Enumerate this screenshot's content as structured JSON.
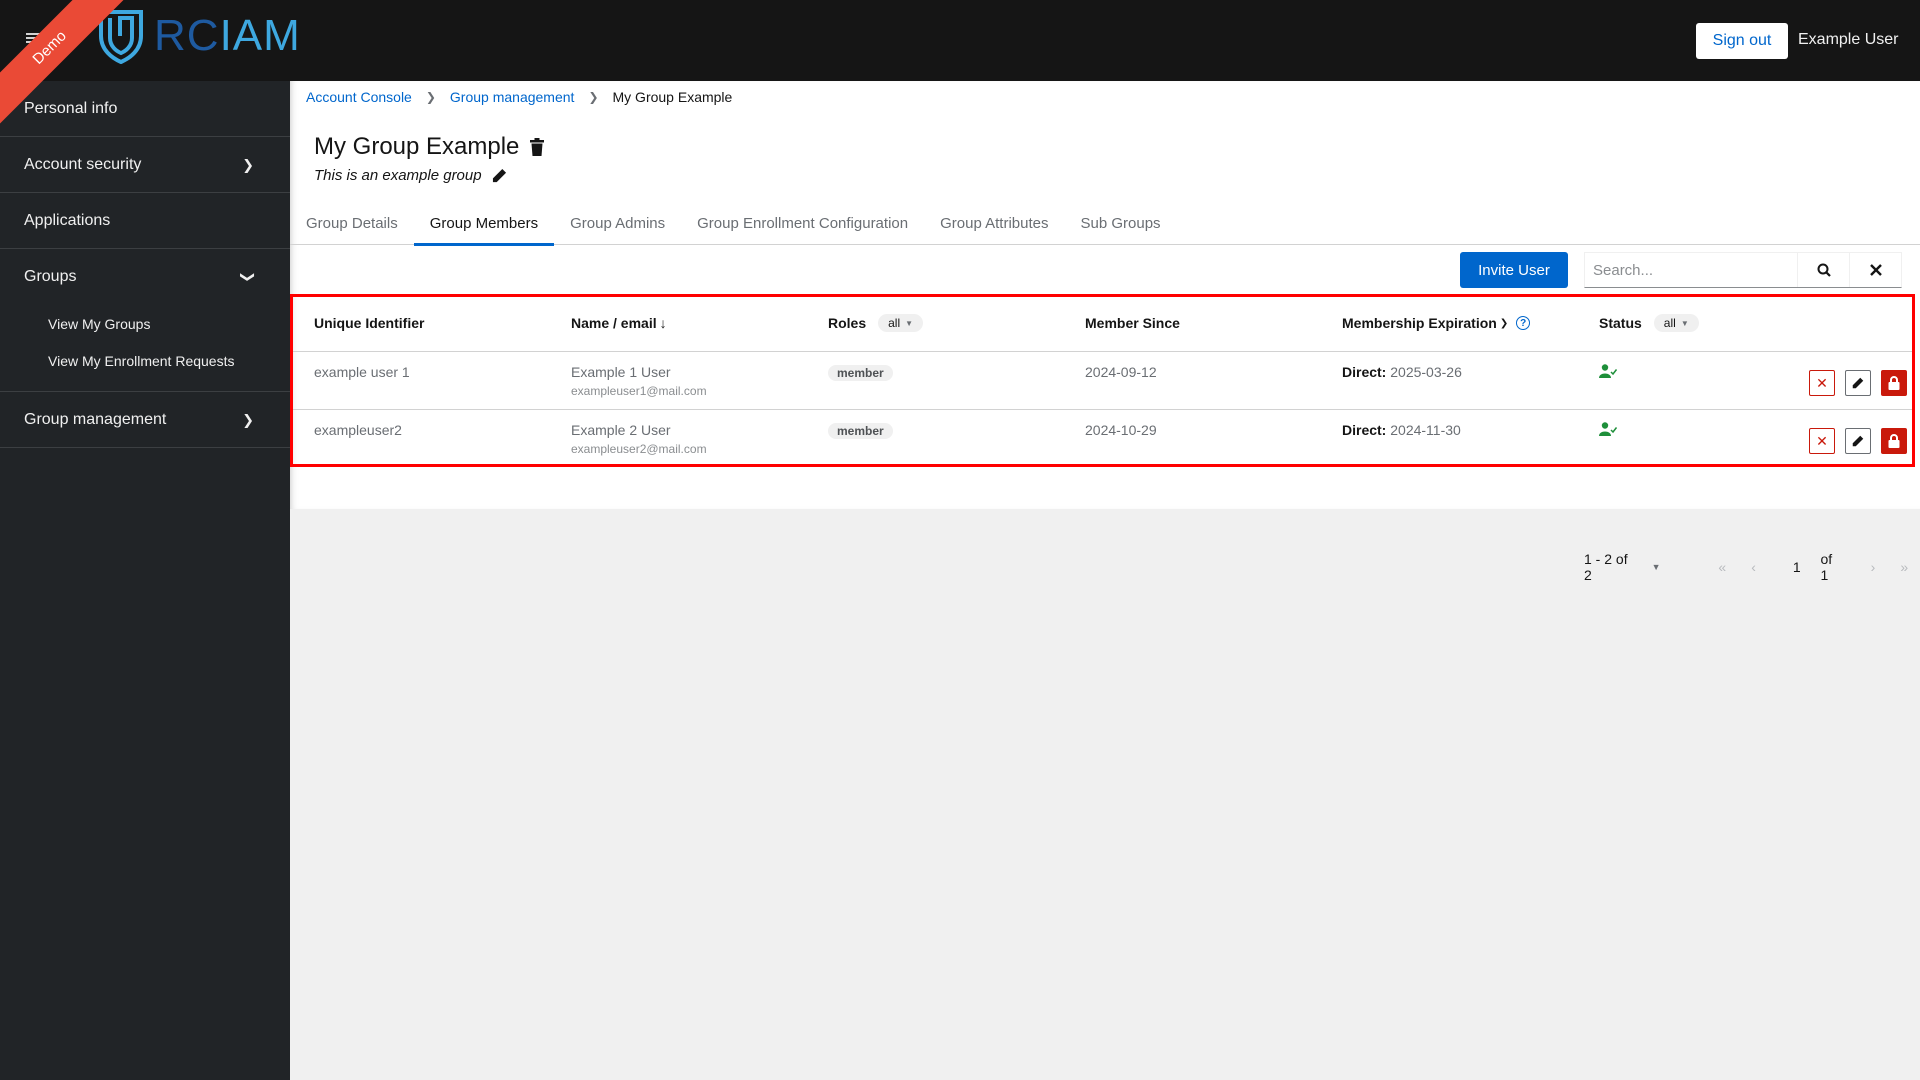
{
  "header": {
    "ribbon_label": "Demo",
    "logo_text_rc": "RC",
    "logo_text_iam": "IAM",
    "signout_label": "Sign out",
    "user_name": "Example User"
  },
  "sidebar": {
    "items": [
      {
        "label": "Personal info"
      },
      {
        "label": "Account security",
        "icon": "chevron-right-icon"
      },
      {
        "label": "Applications"
      },
      {
        "label": "Groups",
        "icon": "chevron-down-icon",
        "children": [
          {
            "label": "View My Groups"
          },
          {
            "label": "View My Enrollment Requests"
          }
        ]
      },
      {
        "label": "Group management",
        "icon": "chevron-right-icon"
      }
    ]
  },
  "breadcrumb": {
    "items": [
      "Account Console",
      "Group management",
      "My Group Example"
    ]
  },
  "page": {
    "title": "My Group Example",
    "description": "This is an example group"
  },
  "tabs": [
    {
      "label": "Group Details",
      "active": false
    },
    {
      "label": "Group Members",
      "active": true
    },
    {
      "label": "Group Admins",
      "active": false
    },
    {
      "label": "Group Enrollment Configuration",
      "active": false
    },
    {
      "label": "Group Attributes",
      "active": false
    },
    {
      "label": "Sub Groups",
      "active": false
    }
  ],
  "toolbar": {
    "invite_label": "Invite User",
    "search_placeholder": "Search...",
    "search_value": ""
  },
  "table": {
    "headers": {
      "id": "Unique Identifier",
      "name": "Name / email",
      "name_sort": "↓",
      "roles": "Roles",
      "roles_filter": "all",
      "since": "Member Since",
      "expiration": "Membership Expiration",
      "status": "Status",
      "status_filter": "all"
    },
    "rows": [
      {
        "id": "example user 1",
        "name": "Example 1 User",
        "email": "exampleuser1@mail.com",
        "role": "member",
        "since": "2024-09-12",
        "exp_label": "Direct:",
        "exp_date": "2025-03-26",
        "status": "active-member-icon"
      },
      {
        "id": "exampleuser2",
        "name": "Example 2 User",
        "email": "exampleuser2@mail.com",
        "role": "member",
        "since": "2024-10-29",
        "exp_label": "Direct:",
        "exp_date": "2024-11-30",
        "status": "active-member-icon"
      }
    ]
  },
  "pagination": {
    "range": "1 - 2 of 2",
    "current_page": "1",
    "of_pages": "of 1"
  },
  "colors": {
    "accent": "#0066cc",
    "danger": "#c9190b",
    "status_active": "#1e8f3a",
    "ribbon": "#ea4a36"
  }
}
